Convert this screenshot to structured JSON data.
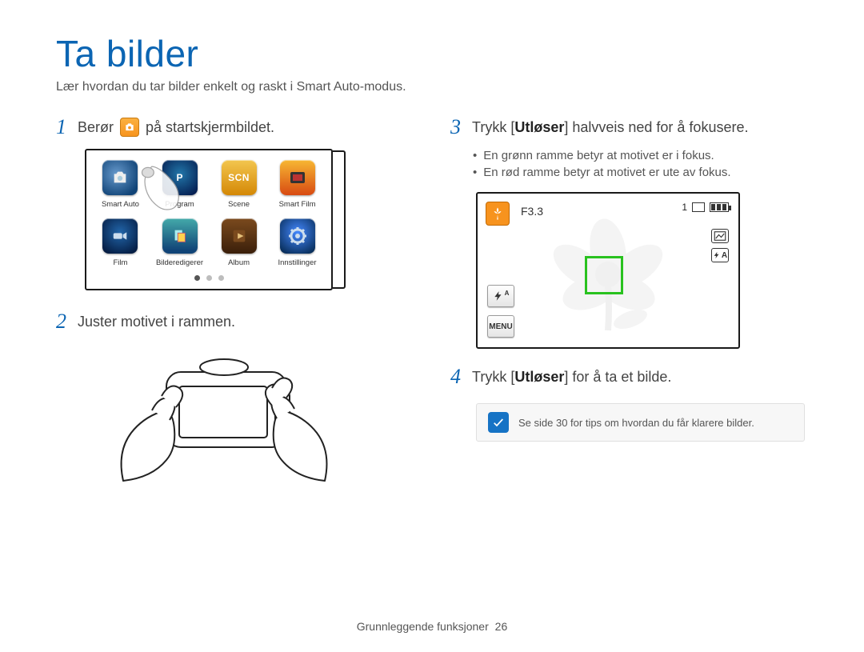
{
  "title": "Ta bilder",
  "subtitle": "Lær hvordan du tar bilder enkelt og raskt i Smart Auto-modus.",
  "steps": {
    "s1": {
      "num": "1",
      "before": "Berør",
      "after": "på startskjermbildet."
    },
    "s2": {
      "num": "2",
      "text": "Juster motivet i rammen."
    },
    "s3": {
      "num": "3",
      "before": "Trykk [",
      "bold": "Utløser",
      "after": "] halvveis ned for å fokusere."
    },
    "s4": {
      "num": "4",
      "before": "Trykk [",
      "bold": "Utløser",
      "after": "] for å ta et bilde."
    }
  },
  "bullets": {
    "b1": "En grønn ramme betyr at motivet er i fokus.",
    "b2": "En rød ramme betyr at motivet er ute av fokus."
  },
  "apps": {
    "smartauto": "Smart Auto",
    "program": "Program",
    "scene": "Scene",
    "smartfilm": "Smart Film",
    "film": "Film",
    "editor": "Bilderedigerer",
    "album": "Album",
    "settings": "Innstillinger",
    "p_glyph": "P",
    "scene_glyph": "SCN"
  },
  "lcd": {
    "fnumber": "F3.3",
    "shots": "1",
    "menu": "MENU",
    "flash_suffix": "A",
    "right_suffix": "A"
  },
  "note": "Se side 30 for tips om hvordan du får klarere bilder.",
  "footer": {
    "section": "Grunnleggende funksjoner",
    "page": "26"
  }
}
